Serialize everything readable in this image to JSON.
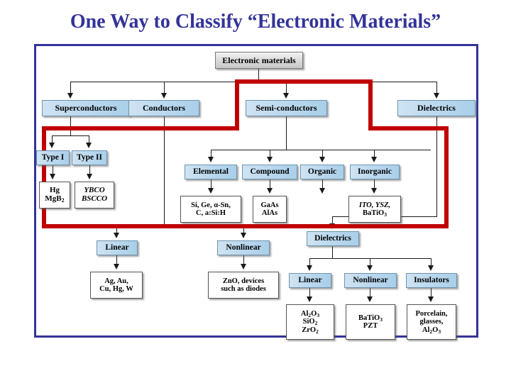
{
  "title": "One Way to Classify “Electronic Materials”",
  "colors": {
    "title": "#333399",
    "frame_border": "#333399",
    "highlight": "#c00000",
    "category_fill": "#bcd9ef",
    "root_fill": "#d9d9d9",
    "example_fill": "#ffffff",
    "connector": "#1a1a1a"
  },
  "diagram": {
    "type": "tree-classification",
    "root": "Electronic materials",
    "nodes": {
      "root": "Electronic materials",
      "superconductors": "Superconductors",
      "conductors": "Conductors",
      "semiconductors": "Semi-conductors",
      "dielectrics_top": "Dielectrics",
      "type_i": "Type I",
      "type_ii": "Type II",
      "type_i_ex_line1": "Hg",
      "type_i_ex_line2": "MgB",
      "type_i_ex_sub2": "2",
      "type_ii_ex_line1": "YBCO",
      "type_ii_ex_line2": "BSCCO",
      "elemental": "Elemental",
      "compound": "Compound",
      "organic": "Organic",
      "inorganic": "Inorganic",
      "elemental_ex_line1": "Si, Ge, α-Sn,",
      "elemental_ex_line2": "C, a:Si:H",
      "compound_ex_line1": "GaAs",
      "compound_ex_line2": "AlAs",
      "inorganic_ex_line1": "ITO, YSZ,",
      "inorganic_ex_line2": "BaTiO",
      "inorganic_ex_sub2": "3",
      "cond_linear": "Linear",
      "cond_nonlinear": "Nonlinear",
      "cond_linear_ex_line1": "Ag, Au,",
      "cond_linear_ex_line2": "Cu, Hg, W",
      "cond_nonlinear_ex_line1": "ZnO, devices",
      "cond_nonlinear_ex_line2": "such as diodes",
      "dielectrics_mid": "Dielectrics",
      "diel_linear": "Linear",
      "diel_nonlinear": "Nonlinear",
      "diel_insulators": "Insulators",
      "diel_linear_ex_line1": "Al",
      "diel_linear_ex_sub1": "2",
      "diel_linear_ex_line1b": "O",
      "diel_linear_ex_sub1b": "3",
      "diel_linear_ex_line2": "SiO",
      "diel_linear_ex_sub2": "2",
      "diel_linear_ex_line3": "ZrO",
      "diel_linear_ex_sub3": "2",
      "diel_nonlinear_ex_line1": "BaTiO",
      "diel_nonlinear_ex_sub1": "3",
      "diel_nonlinear_ex_line2": "PZT",
      "diel_insulators_ex_line1": "Porcelain,",
      "diel_insulators_ex_line2": "glasses,",
      "diel_insulators_ex_line3": "Al",
      "diel_insulators_ex_sub3": "2",
      "diel_insulators_ex_line3b": "O",
      "diel_insulators_ex_sub3b": "3"
    },
    "highlight": {
      "label": "semiconductor-branch-highlight",
      "color": "#c00000",
      "encloses": [
        "Semi-conductors",
        "Elemental",
        "Compound",
        "Organic",
        "Inorganic"
      ]
    }
  }
}
